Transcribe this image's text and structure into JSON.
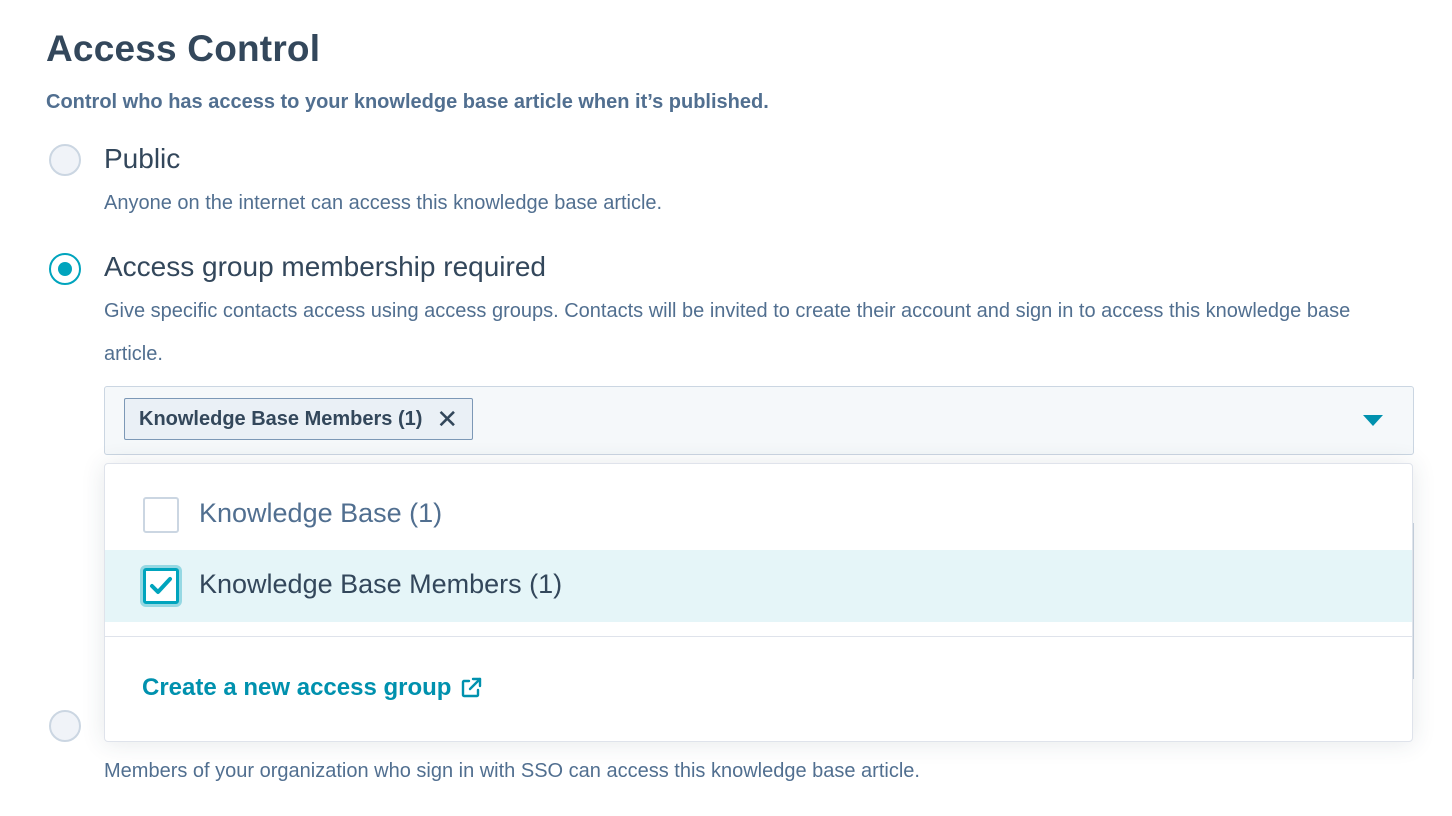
{
  "section": {
    "title": "Access Control",
    "subtitle": "Control who has access to your knowledge base article when it’s published."
  },
  "options": [
    {
      "label": "Public",
      "description": "Anyone on the internet can access this knowledge base article.",
      "selected": false
    },
    {
      "label": "Access group membership required",
      "description": "Give specific contacts access using access groups. Contacts will be invited to create their account and sign in to access this knowledge base article.",
      "selected": true
    },
    {
      "label": "",
      "description": "Members of your organization who sign in with SSO can access this knowledge base article.",
      "selected": false
    }
  ],
  "access_group_select": {
    "selected_tags": [
      {
        "label": "Knowledge Base Members (1)",
        "remove_icon": "close-icon"
      }
    ],
    "caret_icon": "caret-down-icon"
  },
  "dropdown": {
    "items": [
      {
        "label": "Knowledge Base (1)",
        "checked": false
      },
      {
        "label": "Knowledge Base Members (1)",
        "checked": true
      }
    ],
    "create_link": {
      "label": "Create a new access group",
      "icon": "external-link-icon"
    }
  },
  "colors": {
    "accent": "#00a4bd",
    "link": "#0091ae",
    "heading": "#33475b",
    "secondary_text": "#516f90",
    "selected_row": "#e5f5f8"
  }
}
